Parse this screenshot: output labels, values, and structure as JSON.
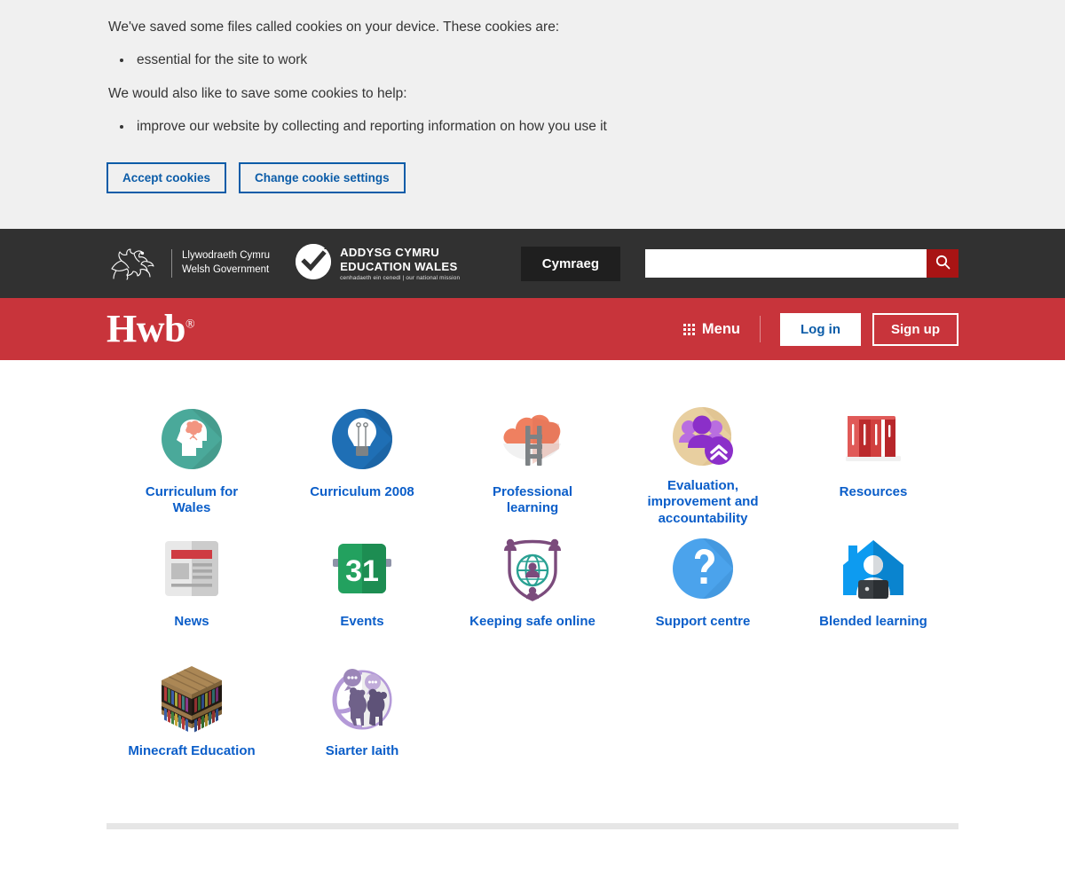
{
  "cookie_banner": {
    "paragraph_1": "We've saved some files called cookies on your device. These cookies are:",
    "bullet_1": "essential for the site to work",
    "paragraph_2": "We would also like to save some cookies to help:",
    "bullet_2": "improve our website by collecting and reporting information on how you use it",
    "accept_label": "Accept cookies",
    "settings_label": "Change cookie settings",
    "background_color": "#f0f0f0",
    "link_color": "#0b5ca8"
  },
  "header": {
    "welsh_gov_logo": {
      "icon": "welsh-dragon-icon",
      "line_1": "Llywodraeth Cymru",
      "line_2": "Welsh Government"
    },
    "education_wales_logo": {
      "icon": "checkmark-circle-icon",
      "line_1": "ADDYSG CYMRU",
      "line_2": "EDUCATION WALES",
      "tagline": "cenhadaeth ein cenedl | our national mission"
    },
    "language_toggle": "Cymraeg",
    "search": {
      "value": "",
      "placeholder": "",
      "button_icon": "search-icon",
      "button_color": "#a81414"
    },
    "background_color": "#313131"
  },
  "nav": {
    "brand": "Hwb",
    "brand_mark": "®",
    "menu_label": "Menu",
    "menu_icon": "grid-3x3-icon",
    "login_label": "Log in",
    "signup_label": "Sign up",
    "background_color": "#c8343b"
  },
  "tiles": [
    {
      "label": "Curriculum for Wales",
      "icon": "head-brain-icon"
    },
    {
      "label": "Curriculum 2008",
      "icon": "lightbulb-icon"
    },
    {
      "label": "Professional learning",
      "icon": "cloud-ladder-icon"
    },
    {
      "label": "Evaluation, improvement and accountability",
      "icon": "people-chevron-icon"
    },
    {
      "label": "Resources",
      "icon": "books-icon"
    },
    {
      "label": "News",
      "icon": "newspaper-icon"
    },
    {
      "label": "Events",
      "icon": "calendar-31-icon"
    },
    {
      "label": "Keeping safe online",
      "icon": "shield-globe-icon"
    },
    {
      "label": "Support centre",
      "icon": "question-mark-icon"
    },
    {
      "label": "Blended learning",
      "icon": "house-person-laptop-icon"
    },
    {
      "label": "Minecraft Education",
      "icon": "minecraft-bookshelf-icon"
    },
    {
      "label": "Siarter Iaith",
      "icon": "speech-figures-icon"
    }
  ],
  "tile_label_color": "#0b5ec9",
  "events_day_number": "31"
}
